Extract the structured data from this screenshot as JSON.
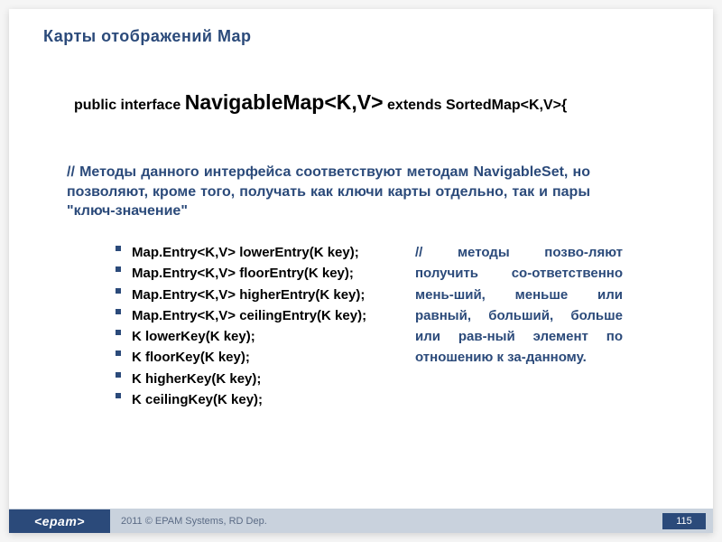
{
  "title": "Карты отображений Map",
  "declaration": {
    "prefix": "public interface ",
    "name": "NavigableMap",
    "generics1": "<K,V>",
    "extends": " extends SortedMap<K,V>",
    "brace": "{"
  },
  "comment_intro": "// Методы данного интерфейса соответствуют методам NavigableSet, но позволяют, кроме того, получать как ключи карты отдельно, так и пары \"ключ-значение\"",
  "methods": [
    "Map.Entry<K,V> lowerEntry(K key);",
    "Map.Entry<K,V> floorEntry(K key);",
    "Map.Entry<K,V> higherEntry(K key);",
    "Map.Entry<K,V> ceilingEntry(K key);",
    "K lowerKey(K key);",
    "K floorKey(K key);",
    "K higherKey(K key);",
    "K ceilingKey(K key);"
  ],
  "side_note": "// методы позво-ляют получить со-ответственно мень-ший, меньше или равный, больший, больше или рав-ный элемент по отношению к за-данному.",
  "footer": {
    "logo": "<epam>",
    "copyright": "2011 © EPAM Systems, RD Dep.",
    "page": "115"
  }
}
